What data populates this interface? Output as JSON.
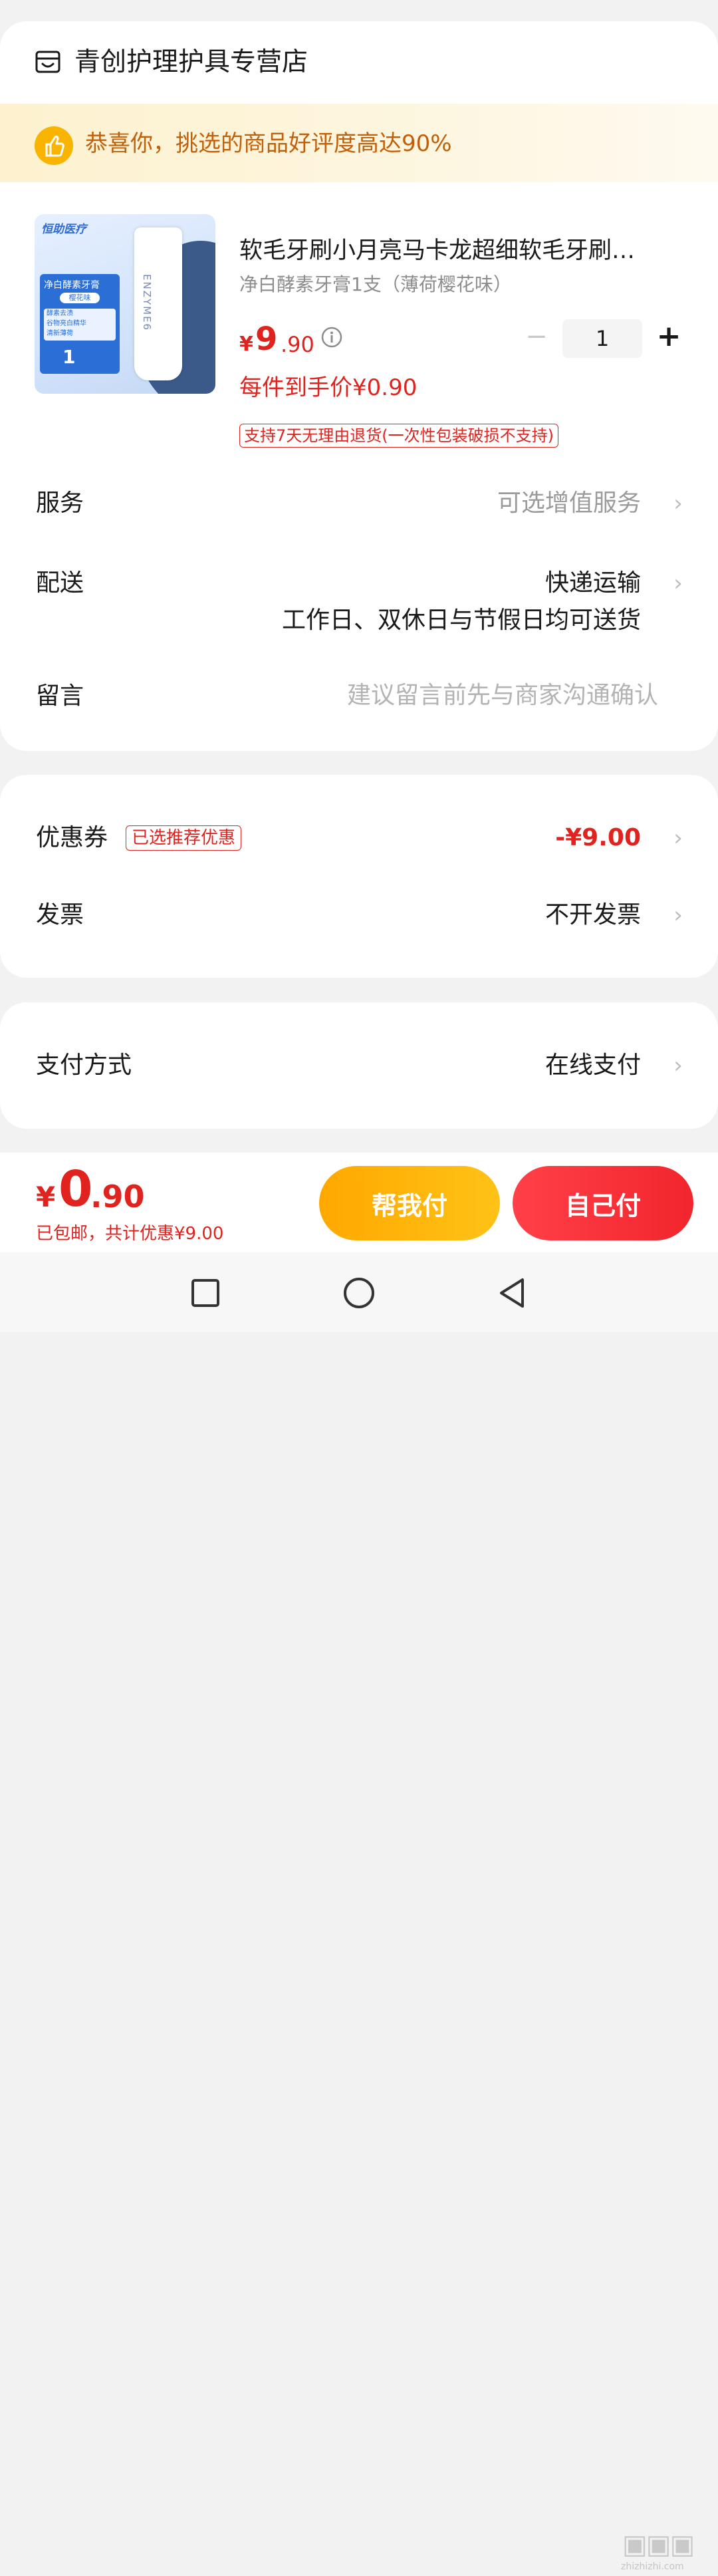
{
  "store": {
    "name": "青创护理护具专营店",
    "icon": "store-icon"
  },
  "praise_banner": {
    "icon": "thumbs-up-icon",
    "text": "恭喜你，挑选的商品好评度高达90%"
  },
  "product": {
    "thumbnail": {
      "brand": "恒助医疗",
      "tube_text": "ENZYME6",
      "label_title": "净白酵素牙膏",
      "label_flavor": "樱花味",
      "label_lines": [
        "酵素去渍",
        "谷物亮白精华",
        "清新薄荷"
      ],
      "label_count": "1"
    },
    "title": "软毛牙刷小月亮马卡龙超细软毛牙刷…",
    "variant": "净白酵素牙膏1支（薄荷樱花味）",
    "price_symbol": "¥",
    "price_int": "9",
    "price_dec": ".90",
    "quantity": "1",
    "minus_label": "−",
    "plus_label": "+",
    "unit_price": "每件到手价¥0.90",
    "return_policy": "支持7天无理由退货(一次性包装破损不支持)"
  },
  "service": {
    "label": "服务",
    "value": "可选增值服务"
  },
  "delivery": {
    "label": "配送",
    "value": "快递运输",
    "detail": "工作日、双休日与节假日均可送货"
  },
  "message": {
    "label": "留言",
    "placeholder": "建议留言前先与商家沟通确认",
    "value": ""
  },
  "coupon": {
    "label": "优惠券",
    "tag": "已选推荐优惠",
    "value": "-¥9.00"
  },
  "invoice": {
    "label": "发票",
    "value": "不开发票"
  },
  "payment": {
    "label": "支付方式",
    "value": "在线支付"
  },
  "chevron": "›",
  "bottom": {
    "total_symbol": "¥",
    "total_int": "0",
    "total_dec": ".90",
    "note_prefix": "已包邮，共计优惠",
    "note_amount": "¥9.00",
    "help_pay_label": "帮我付",
    "self_pay_label": "自己付"
  },
  "nav": {
    "recent_icon": "square-recent-apps-icon",
    "home_icon": "circle-home-icon",
    "back_icon": "triangle-back-icon"
  },
  "watermark": {
    "text": "zhizhizhi.com"
  },
  "colors": {
    "accent_red": "#e0231e",
    "help_pay": "#ffb000",
    "self_pay": "#f53038",
    "banner_text": "#c25f08"
  }
}
